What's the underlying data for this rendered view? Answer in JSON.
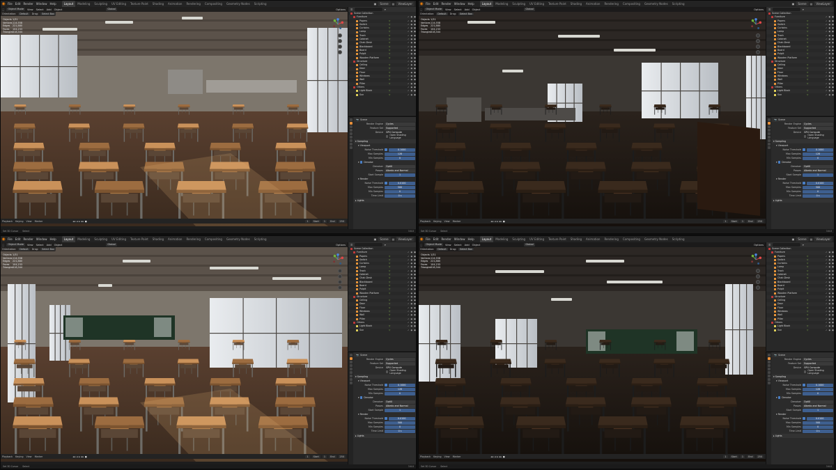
{
  "app": {
    "menu": [
      "File",
      "Edit",
      "Render",
      "Window",
      "Help"
    ],
    "workspaces": [
      "Layout",
      "Modeling",
      "Sculpting",
      "UV Editing",
      "Texture Paint",
      "Shading",
      "Animation",
      "Rendering",
      "Compositing",
      "Geometry Nodes",
      "Scripting"
    ],
    "active_workspace": "Layout",
    "scene": "Scene",
    "view_layer": "ViewLayer"
  },
  "viewport": {
    "mode": "Object Mode",
    "menus": [
      "View",
      "Select",
      "Add",
      "Object"
    ],
    "orientation_label": "Orientation:",
    "orientation": "Default",
    "drag_label": "Drag:",
    "drag": "Select Box",
    "transform": "Global",
    "options": "Options"
  },
  "stats": {
    "labels": [
      "Objects",
      "Vertices",
      "Edges",
      "Faces",
      "Triangles"
    ],
    "values": [
      "1/31",
      "114,558",
      "221,880",
      "104,233",
      "218,344"
    ]
  },
  "outliner": {
    "root": "Scene Collection",
    "rows": [
      {
        "name": "Furniture",
        "type": "col",
        "indent": 1
      },
      {
        "name": "Papers",
        "type": "obj",
        "indent": 2
      },
      {
        "name": "Switch",
        "type": "obj",
        "indent": 2
      },
      {
        "name": "Curtains",
        "type": "obj",
        "indent": 2
      },
      {
        "name": "Lamp",
        "type": "obj",
        "indent": 2
      },
      {
        "name": "Trash",
        "type": "obj",
        "indent": 2
      },
      {
        "name": "Cabinet",
        "type": "obj",
        "indent": 2
      },
      {
        "name": "Chair-Desk",
        "type": "obj",
        "indent": 2
      },
      {
        "name": "Blackboard",
        "type": "obj",
        "indent": 2
      },
      {
        "name": "Board",
        "type": "obj",
        "indent": 2
      },
      {
        "name": "Pulpit",
        "type": "obj",
        "indent": 2
      },
      {
        "name": "Wooden Platform",
        "type": "obj",
        "indent": 2
      },
      {
        "name": "Structure",
        "type": "col",
        "indent": 1
      },
      {
        "name": "Ceiling",
        "type": "obj",
        "indent": 2
      },
      {
        "name": "Door",
        "type": "obj",
        "indent": 2
      },
      {
        "name": "Floor",
        "type": "obj",
        "indent": 2
      },
      {
        "name": "Windows",
        "type": "obj",
        "indent": 2
      },
      {
        "name": "Wall",
        "type": "obj",
        "indent": 2
      },
      {
        "name": "Pillar",
        "type": "obj",
        "indent": 2
      },
      {
        "name": "Others",
        "type": "col",
        "indent": 1
      },
      {
        "name": "Light Block",
        "type": "lit",
        "indent": 2
      },
      {
        "name": "Sun",
        "type": "lit",
        "indent": 2
      }
    ]
  },
  "properties": {
    "header": "Scene",
    "render_engine_label": "Render Engine",
    "render_engine": "Cycles",
    "feature_set_label": "Feature Set",
    "feature_set": "Supported",
    "device_label": "Device",
    "device": "GPU Compute",
    "osl": "Open Shading Language",
    "sampling": "Sampling",
    "viewport": "Viewport",
    "noise_threshold_label": "Noise Threshold",
    "noise_threshold_vp": "0.1000",
    "max_samples_label": "Max Samples",
    "max_samples_vp": "128",
    "min_samples_label": "Min Samples",
    "min_samples_vp": "0",
    "denoise": "Denoise",
    "denoiser_label": "Denoiser",
    "denoiser": "OptiX",
    "passes_label": "Passes",
    "passes": "Albedo and Normal",
    "start_sample_label": "Start Sample",
    "start_sample": "1",
    "render": "Render",
    "noise_threshold_r": "0.0100",
    "max_samples_r": "500",
    "min_samples_r": "0",
    "time_limit_label": "Time Limit",
    "time_limit": "0 s",
    "lights": "Lights"
  },
  "timeline": {
    "items": [
      "Playback",
      "Keying",
      "View",
      "Marker"
    ],
    "frame": "1",
    "start_label": "Start",
    "start": "1",
    "end_label": "End",
    "end": "250"
  },
  "status": {
    "items": [
      "Set 3D Cursor",
      "Select"
    ],
    "version": "3.6.0"
  }
}
